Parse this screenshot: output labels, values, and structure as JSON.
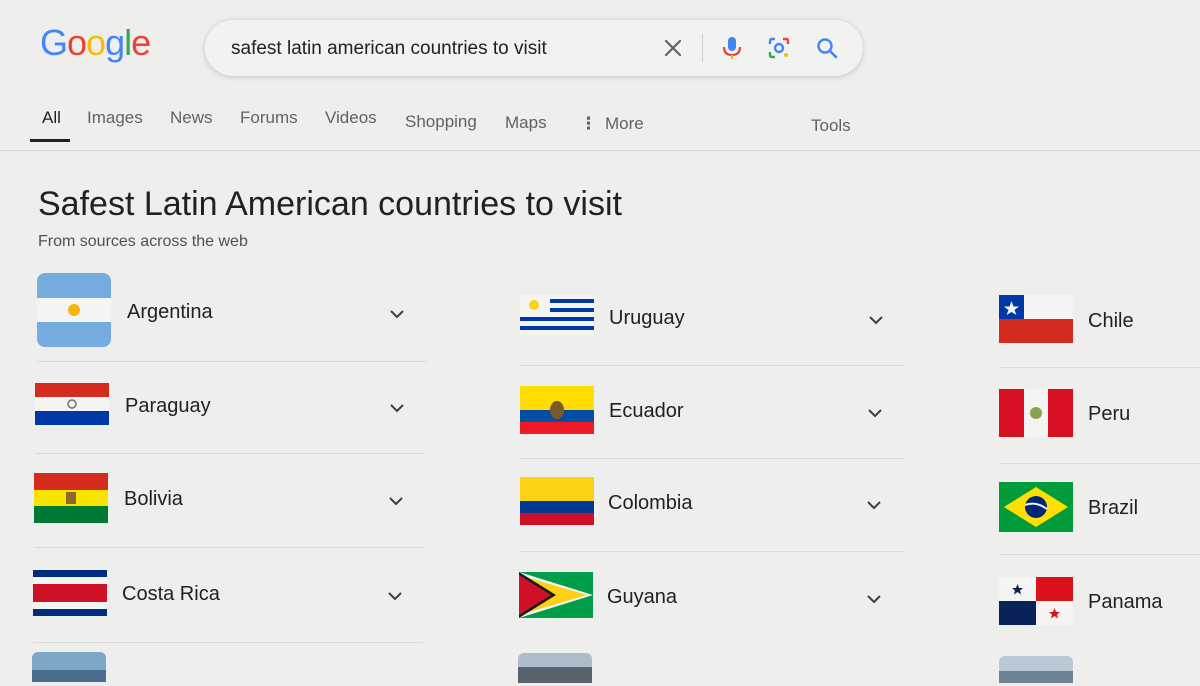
{
  "search": {
    "logo": "Google",
    "query": "safest latin american countries to visit"
  },
  "tabs": [
    "All",
    "Images",
    "News",
    "Forums",
    "Videos",
    "Shopping",
    "Maps",
    "More"
  ],
  "tools": "Tools",
  "section": {
    "title": "Safest Latin American countries to visit",
    "subtitle": "From sources across the web"
  },
  "columns": [
    [
      "Argentina",
      "Paraguay",
      "Bolivia",
      "Costa Rica"
    ],
    [
      "Uruguay",
      "Ecuador",
      "Colombia",
      "Guyana"
    ],
    [
      "Chile",
      "Peru",
      "Brazil",
      "Panama"
    ]
  ],
  "icons": {
    "clear": "close-icon",
    "voice": "microphone-icon",
    "lens": "camera-lens-icon",
    "search": "search-icon",
    "expand": "chevron-down-icon"
  },
  "colors": {
    "google_blue": "#4285f4",
    "google_red": "#ea4335",
    "google_yellow": "#fbbc05",
    "google_green": "#34a853"
  }
}
